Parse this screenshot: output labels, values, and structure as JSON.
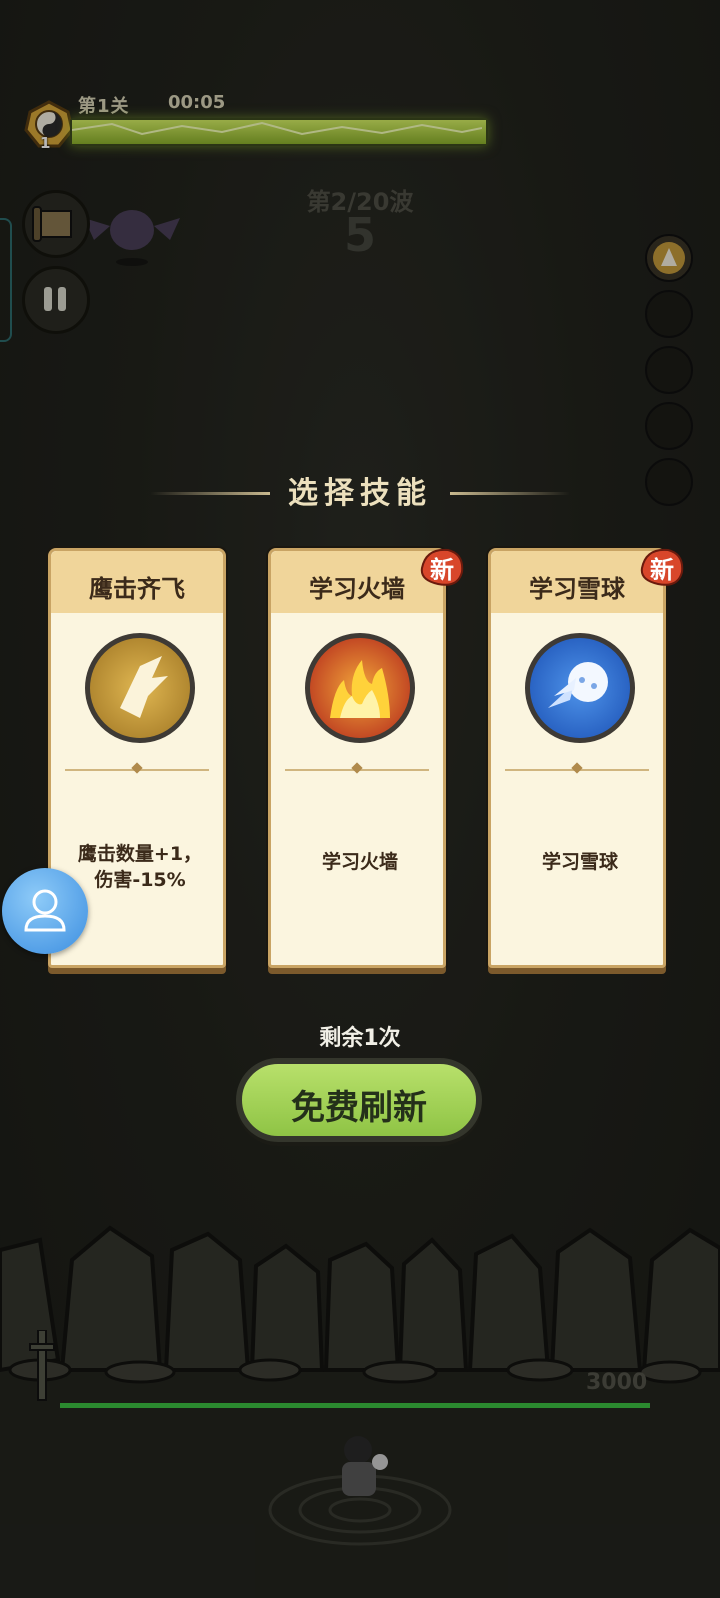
{
  "hud": {
    "level_label": "第1关",
    "timer": "00:05",
    "player_level": "1",
    "xp_percent": 100,
    "wave_label": "第2/20波",
    "countdown": "5"
  },
  "skill_select": {
    "header": "选择技能",
    "cards": [
      {
        "title": "鹰击齐飞",
        "desc_line1": "鹰击数量+1，",
        "desc_line2": "伤害-15%",
        "icon": "eagle-icon",
        "is_new": false,
        "icon_color": "#b88a2e"
      },
      {
        "title": "学习火墙",
        "desc_line1": "学习火墙",
        "desc_line2": "",
        "icon": "fire-icon",
        "is_new": true,
        "new_label": "新",
        "icon_color": "#c0291a"
      },
      {
        "title": "学习雪球",
        "desc_line1": "学习雪球",
        "desc_line2": "",
        "icon": "snowball-icon",
        "is_new": true,
        "new_label": "新",
        "icon_color": "#2a6fd0"
      }
    ],
    "remaining_label": "剩余1次",
    "refresh_button": "免费刷新"
  },
  "wall": {
    "hp": "3000"
  },
  "colors": {
    "accent_green": "#a4d15a",
    "card_bg": "#fbf5df",
    "new_tag": "#d8462a"
  }
}
